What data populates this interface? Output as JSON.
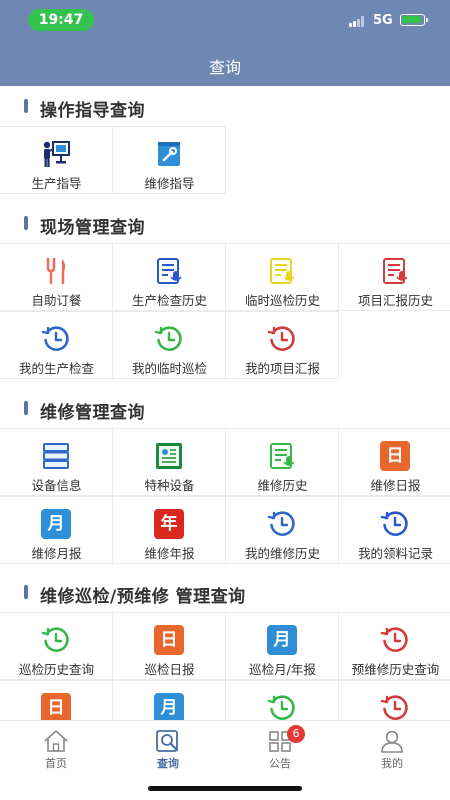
{
  "status": {
    "time": "19:47",
    "network": "5G"
  },
  "header": {
    "title": "查询"
  },
  "sections": [
    {
      "title": "操作指导查询"
    },
    {
      "title": "现场管理查询"
    },
    {
      "title": "维修管理查询"
    },
    {
      "title": "维修巡检/预维修 管理查询"
    }
  ],
  "items": {
    "s0_0": {
      "label": "生产指导",
      "icon": "presentation-icon"
    },
    "s0_1": {
      "label": "维修指导",
      "icon": "wrench-book-icon"
    },
    "s1_0": {
      "label": "自助订餐",
      "icon": "fork-knife-icon"
    },
    "s1_1": {
      "label": "生产检查历史",
      "icon": "doc-mic-icon",
      "color": "#2757c9"
    },
    "s1_2": {
      "label": "临时巡检历史",
      "icon": "doc-mic-icon",
      "color": "#e8d51f"
    },
    "s1_3": {
      "label": "项目汇报历史",
      "icon": "doc-mic-icon",
      "color": "#d33a3a"
    },
    "s1_4": {
      "label": "我的生产检查",
      "icon": "clock-history-icon",
      "color": "#2f67c7"
    },
    "s1_5": {
      "label": "我的临时巡检",
      "icon": "clock-history-icon",
      "color": "#37b548"
    },
    "s1_6": {
      "label": "我的项目汇报",
      "icon": "clock-history-icon",
      "color": "#d33a3a"
    },
    "s2_0": {
      "label": "设备信息",
      "icon": "server-icon"
    },
    "s2_1": {
      "label": "特种设备",
      "icon": "gear-board-icon"
    },
    "s2_2": {
      "label": "维修历史",
      "icon": "doc-mic-icon",
      "color": "#37b548"
    },
    "s2_3": {
      "label": "维修日报",
      "icon": "day-box-icon",
      "text": "日",
      "color": "#e8672c"
    },
    "s2_4": {
      "label": "维修月报",
      "icon": "month-box-icon",
      "text": "月",
      "color": "#2f8fd6"
    },
    "s2_5": {
      "label": "维修年报",
      "icon": "year-box-icon",
      "text": "年",
      "color": "#d9281e"
    },
    "s2_6": {
      "label": "我的维修历史",
      "icon": "clock-history-icon",
      "color": "#2f67c7"
    },
    "s2_7": {
      "label": "我的领料记录",
      "icon": "clock-history-icon",
      "color": "#2757c9"
    },
    "s3_0": {
      "label": "巡检历史查询",
      "icon": "clock-history-icon",
      "color": "#37b548"
    },
    "s3_1": {
      "label": "巡检日报",
      "icon": "day-box-icon",
      "text": "日",
      "color": "#e8672c"
    },
    "s3_2": {
      "label": "巡检月/年报",
      "icon": "month-box-icon",
      "text": "月",
      "color": "#2f8fd6"
    },
    "s3_3": {
      "label": "预维修历史查询",
      "icon": "clock-history-icon",
      "color": "#d33a3a"
    },
    "s3_4": {
      "label": "",
      "icon": "day-box-icon",
      "text": "日",
      "color": "#e8672c"
    },
    "s3_5": {
      "label": "",
      "icon": "month-box-icon",
      "text": "月",
      "color": "#2f8fd6"
    },
    "s3_6": {
      "label": "",
      "icon": "clock-history-icon",
      "color": "#37b548"
    },
    "s3_7": {
      "label": "",
      "icon": "clock-history-icon",
      "color": "#d33a3a"
    }
  },
  "tabbar": {
    "home": "首页",
    "query": "查询",
    "notice": "公告",
    "notice_badge": "6",
    "mine": "我的"
  }
}
